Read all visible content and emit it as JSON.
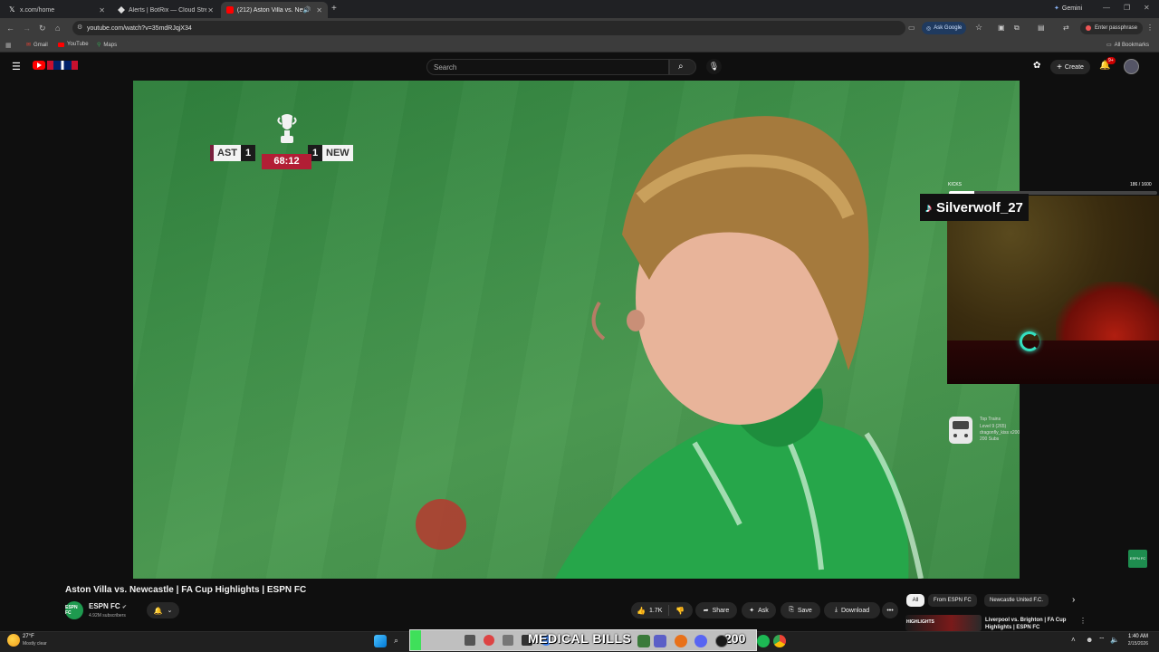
{
  "browser": {
    "tabs": [
      {
        "label": "x.com/home"
      },
      {
        "label": "Alerts | BotRix — Cloud Streami..."
      },
      {
        "label": "(212) Aston Villa vs. Newca..."
      }
    ],
    "gemini_label": "Gemini",
    "url": "youtube.com/watch?v=35mdRJqjX34",
    "ask_google": "Ask Google",
    "passphrase": "Enter passphrase",
    "bookmarks": [
      "Gmail",
      "YouTube",
      "Maps"
    ],
    "all_bookmarks": "All Bookmarks"
  },
  "youtube": {
    "search_placeholder": "Search",
    "create_label": "Create",
    "notif_count": "9+",
    "video_title": "Aston Villa vs. Newcastle | FA Cup Highlights | ESPN FC",
    "channel": {
      "name": "ESPN FC",
      "avatar_text": "ESPN FC",
      "subscribers": "4.92M subscribers"
    },
    "actions": {
      "likes": "1.7K",
      "share": "Share",
      "ask": "Ask",
      "save": "Save",
      "download": "Download"
    },
    "chips": [
      "All",
      "From ESPN FC",
      "Newcastle United F.C."
    ],
    "next_video": {
      "title": "Liverpool vs. Brighton | FA Cup Highlights | ESPN FC",
      "thumb_label": "HIGHLIGHTS"
    }
  },
  "scoreboard": {
    "home": "AST",
    "home_goals": "1",
    "away": "NEW",
    "away_goals": "1",
    "clock": "68:12"
  },
  "overlay": {
    "kicks_label": "KICKS",
    "kicks_count": "186 / 1600",
    "kicks_progress": 0.12,
    "streamer": "Silverwolf_27",
    "top_train": {
      "title": "Top Trains",
      "level": "Level 9 (265)",
      "who": "dragonfly_kiss x200",
      "subs": "200 Subs"
    },
    "corner_badge": "ESPN FC"
  },
  "taskbar": {
    "weather_temp": "27°F",
    "weather_desc": "Mostly clear",
    "banner_text": "MEDICAL BILLS",
    "banner_count": "200",
    "time": "1:40 AM",
    "date": "2/15/2026"
  },
  "colors": {
    "yt_red": "#ff0000",
    "pitch_green": "#4c9a52",
    "clock_red": "#b21e35",
    "accent_blue": "#8ab4f8"
  }
}
